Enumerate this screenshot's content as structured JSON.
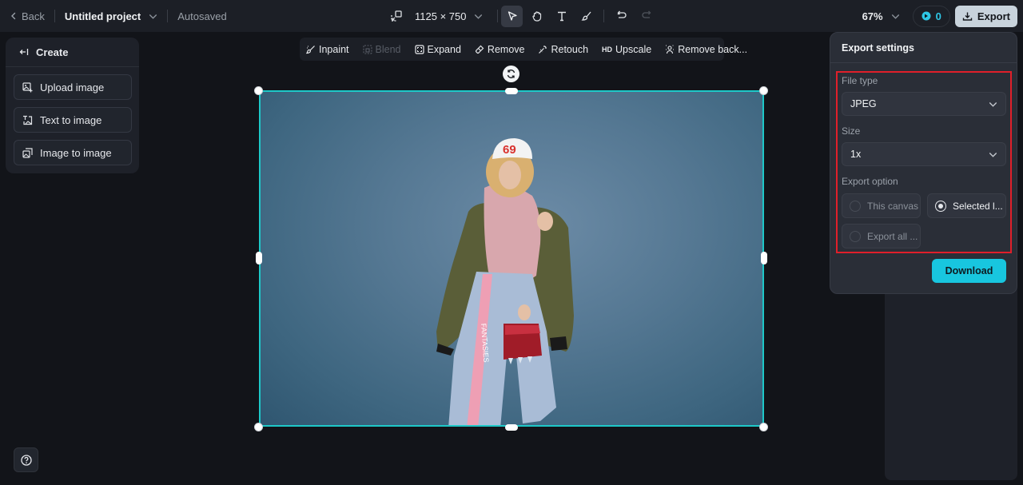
{
  "topbar": {
    "back_label": "Back",
    "project_title": "Untitled project",
    "save_status": "Autosaved",
    "canvas_size": "1125 × 750",
    "zoom_level": "67%",
    "credits": "0",
    "export_label": "Export",
    "tools": [
      {
        "icon": "resize-icon"
      },
      {
        "icon": "select-pointer-icon",
        "active": true
      },
      {
        "icon": "hand-pan-icon"
      },
      {
        "icon": "text-tool-icon"
      },
      {
        "icon": "brush-icon"
      },
      {
        "icon": "undo-icon"
      },
      {
        "icon": "redo-icon",
        "disabled": true
      }
    ]
  },
  "left_panel": {
    "header": "Create",
    "items": [
      {
        "label": "Upload image",
        "icon": "upload-image-icon"
      },
      {
        "label": "Text to image",
        "icon": "text-to-image-icon"
      },
      {
        "label": "Image to image",
        "icon": "image-to-image-icon"
      }
    ]
  },
  "image_tools": [
    {
      "label": "Inpaint",
      "icon": "inpaint-icon",
      "disabled": false
    },
    {
      "label": "Blend",
      "icon": "blend-icon",
      "disabled": true
    },
    {
      "label": "Expand",
      "icon": "expand-icon",
      "disabled": false
    },
    {
      "label": "Remove",
      "icon": "eraser-icon",
      "disabled": false
    },
    {
      "label": "Retouch",
      "icon": "magic-wand-icon",
      "disabled": false
    },
    {
      "label": "Upscale",
      "icon": "hd-icon",
      "icon_text": "HD",
      "disabled": false
    },
    {
      "label": "Remove back...",
      "icon": "remove-background-icon",
      "disabled": false
    }
  ],
  "canvas": {
    "image_description": "Woman in white '69' cap, pink sweater, olive bomber jacket, denim skirt with pink 'FANTASIES' stripe, holding red tasseled bag against a blue backdrop",
    "cap_text": "69",
    "skirt_text": "FANTASIES",
    "selection_color": "#1ec8c8"
  },
  "export_settings": {
    "title": "Export settings",
    "file_type_label": "File type",
    "file_type_value": "JPEG",
    "size_label": "Size",
    "size_value": "1x",
    "export_option_label": "Export option",
    "options": [
      {
        "label": "This canvas",
        "selected": false
      },
      {
        "label": "Selected l...",
        "selected": true
      },
      {
        "label": "Export all ...",
        "selected": false
      }
    ],
    "download_label": "Download",
    "highlight_color": "#e01f2a",
    "accent_color": "#18c6df"
  },
  "help_icon": "help-circle-icon"
}
